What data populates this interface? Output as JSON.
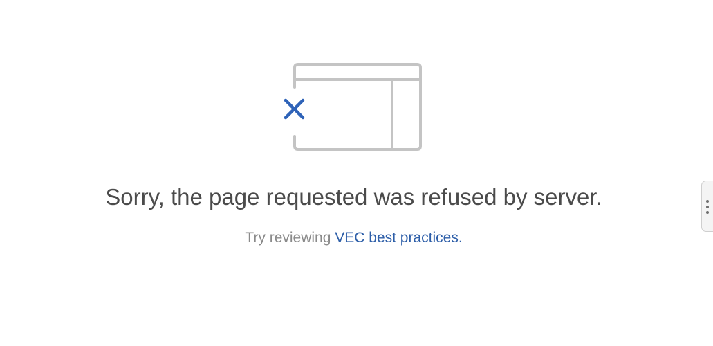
{
  "error": {
    "message": "Sorry, the page requested was refused by server.",
    "hint_prefix": "Try reviewing ",
    "hint_link": "VEC best practices."
  },
  "icons": {
    "illustration": "blocked-window-icon",
    "side_handle": "more-vertical-icon"
  },
  "colors": {
    "frame_stroke": "#c4c4c4",
    "close_mark": "#2f63b8",
    "link": "#2d5ea8",
    "headline": "#4b4b4b",
    "hint": "#8a8a8a"
  }
}
